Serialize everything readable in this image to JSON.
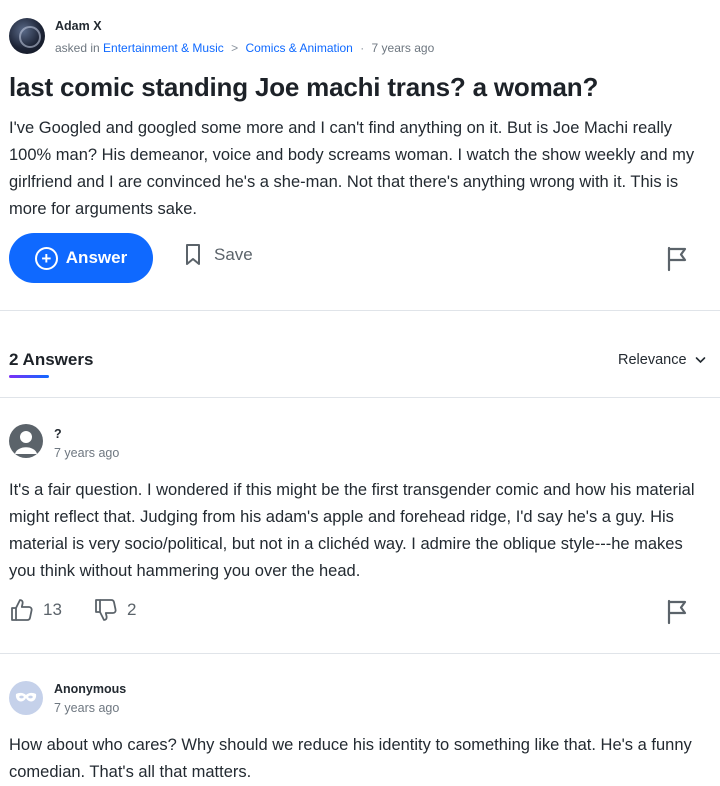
{
  "question": {
    "author": "Adam X",
    "asked_prefix": "asked in",
    "category": "Entertainment & Music",
    "subcategory": "Comics & Animation",
    "time": "7 years ago",
    "title": "last comic standing Joe machi trans? a woman?",
    "body": "I've Googled and googled some more and I can't find anything on it.  But is Joe Machi really 100% man?  His demeanor, voice and body screams woman. I watch the show weekly and my girlfriend and I are convinced he's a she-man.  Not that there's anything wrong with it.  This is more for arguments sake.",
    "answer_label": "Answer",
    "save_label": "Save"
  },
  "answers_section": {
    "count_label": "2 Answers",
    "sort_label": "Relevance"
  },
  "answers": [
    {
      "author": "?",
      "time": "7 years ago",
      "body": "It's a fair question.  I wondered if this might be the first transgender comic and how his material might reflect that.  Judging from his adam's apple and forehead ridge, I'd say he's a guy. His material is very socio/political, but not in a clichéd way.  I admire the oblique style---he makes you think without hammering you over the head.",
      "thumbs_up": "13",
      "thumbs_down": "2"
    },
    {
      "author": "Anonymous",
      "time": "7 years ago",
      "body": "How about who cares? Why should we reduce his identity to something like that. He's a funny comedian. That's all that matters."
    }
  ],
  "colors": {
    "accent": "#0f69ff",
    "text": "#232a31",
    "muted": "#6e7780"
  }
}
